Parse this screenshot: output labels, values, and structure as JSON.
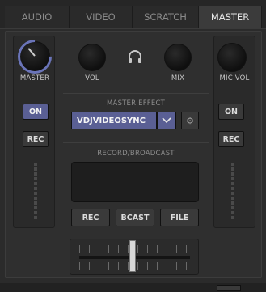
{
  "tabs": [
    {
      "label": "AUDIO",
      "active": false
    },
    {
      "label": "VIDEO",
      "active": false
    },
    {
      "label": "SCRATCH",
      "active": false
    },
    {
      "label": "MASTER",
      "active": true
    }
  ],
  "left_column": {
    "knob_label": "MASTER",
    "on_label": "ON",
    "rec_label": "REC"
  },
  "center": {
    "vol_label": "VOL",
    "mix_label": "MIX",
    "headphone_icon": "headphone-icon",
    "master_effect_header": "MASTER EFFECT",
    "effect_value": "VDJVIDEOSYNC",
    "record_header": "RECORD/BROADCAST",
    "rec_label": "REC",
    "bcast_label": "BCAST",
    "file_label": "FILE"
  },
  "right_column": {
    "knob_label": "MIC VOL",
    "on_label": "ON",
    "rec_label": "REC"
  },
  "colors": {
    "accent": "#5a5f94",
    "knob_ring": "#6a74b8",
    "background": "#2b2b2b"
  }
}
